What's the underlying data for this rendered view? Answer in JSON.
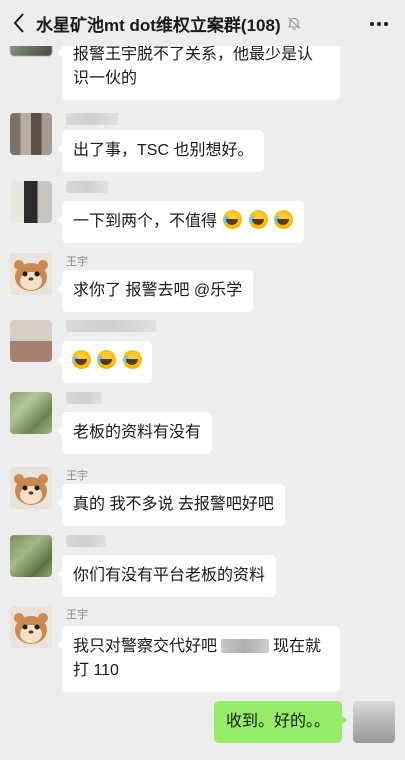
{
  "header": {
    "title": "水星矿池mt dot维权立案群(108)"
  },
  "icons": {
    "back": "chevron-left-icon",
    "mute": "bell-off-icon",
    "more": "more-dots-icon"
  },
  "messages": [
    {
      "line1": "报警王宇脱不了关系，他最少是认",
      "line2": "识一伙的"
    },
    {
      "text": "出了事，TSC 也别想好。"
    },
    {
      "text": "一下到两个，不值得"
    },
    {
      "sender": "王宇",
      "text": "求你了 报警去吧 @乐学"
    },
    {
      "text": ""
    },
    {
      "text": "老板的资料有没有"
    },
    {
      "sender": "王宇",
      "text": "真的 我不多说 去报警吧好吧"
    },
    {
      "text": "你们有没有平台老板的资料"
    },
    {
      "sender": "王宇",
      "line1a": "我只对警察交代好吧",
      "line1b": "现在就",
      "line2": "打 110"
    },
    {
      "text": "收到。好的。。"
    }
  ],
  "colors": {
    "background": "#ededed",
    "my_bubble": "#95ec69",
    "other_bubble": "#ffffff"
  }
}
